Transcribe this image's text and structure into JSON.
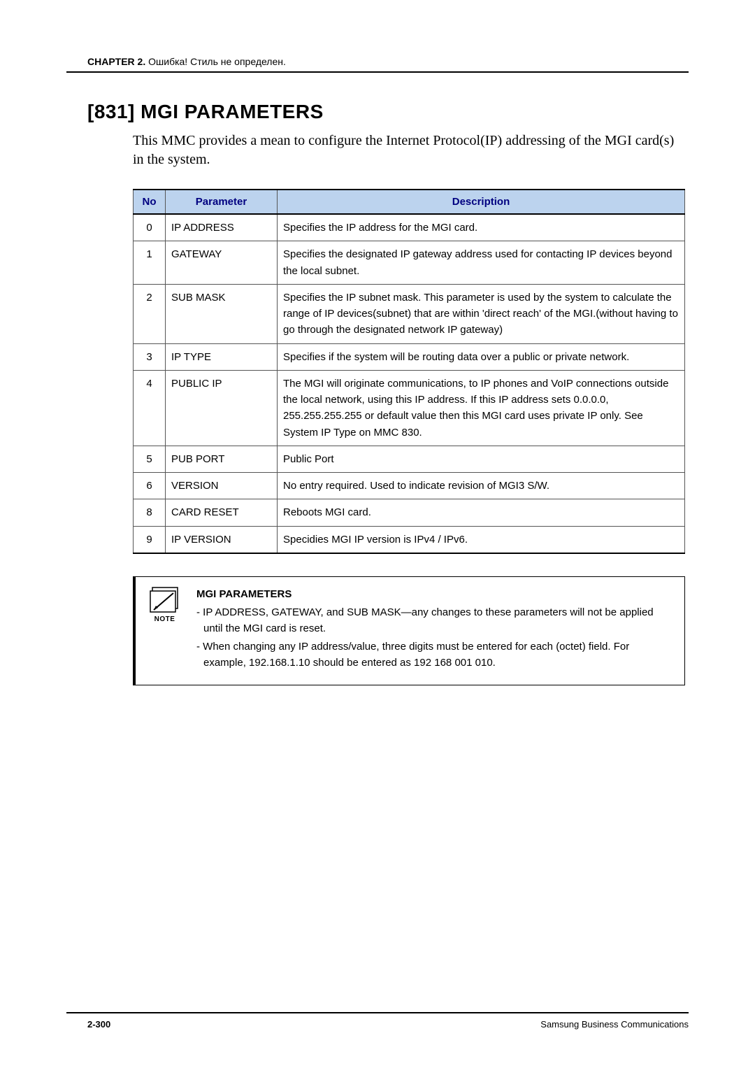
{
  "header": {
    "chapter_label": "CHAPTER 2.",
    "chapter_suffix": " Ошибка! Стиль не определен."
  },
  "title": "[831] MGI PARAMETERS",
  "intro": "This MMC provides a mean to configure the Internet Protocol(IP) addressing of the MGI card(s) in the system.",
  "table": {
    "headers": {
      "no": "No",
      "param": "Parameter",
      "desc": "Description"
    },
    "rows": [
      {
        "no": "0",
        "param": "IP ADDRESS",
        "desc": "Specifies the IP address for the MGI card."
      },
      {
        "no": "1",
        "param": "GATEWAY",
        "desc": "Specifies the designated IP gateway address used for contacting IP devices beyond the local subnet."
      },
      {
        "no": "2",
        "param": "SUB MASK",
        "desc": "Specifies the IP subnet mask. This parameter is used by the system to calculate the range of IP devices(subnet) that are within 'direct reach' of the MGI.(without having to go through the designated network IP gateway)"
      },
      {
        "no": "3",
        "param": "IP TYPE",
        "desc": "Specifies if the system will be routing data over a public or private network."
      },
      {
        "no": "4",
        "param": "PUBLIC IP",
        "desc": "The MGI will originate communications, to IP phones and VoIP connections outside the local network, using this IP address. If this IP address sets 0.0.0.0, 255.255.255.255 or default value then this MGI card uses private IP only. See System IP Type on MMC 830."
      },
      {
        "no": "5",
        "param": "PUB PORT",
        "desc": "Public Port"
      },
      {
        "no": "6",
        "param": "VERSION",
        "desc": "No entry required. Used to indicate revision of MGI3 S/W."
      },
      {
        "no": "8",
        "param": "CARD RESET",
        "desc": "Reboots MGI card."
      },
      {
        "no": "9",
        "param": "IP VERSION",
        "desc": "Specidies MGI IP version is IPv4 / IPv6."
      }
    ]
  },
  "note": {
    "label": "NOTE",
    "title": "MGI PARAMETERS",
    "items": [
      "- IP ADDRESS, GATEWAY, and SUB MASK―any changes to these parameters will not be applied until the MGI card is reset.",
      "- When changing any IP address/value, three digits must be entered for each (octet) field. For example, 192.168.1.10 should be entered as 192 168 001 010."
    ]
  },
  "footer": {
    "page": "2-300",
    "company": "Samsung Business Communications"
  }
}
